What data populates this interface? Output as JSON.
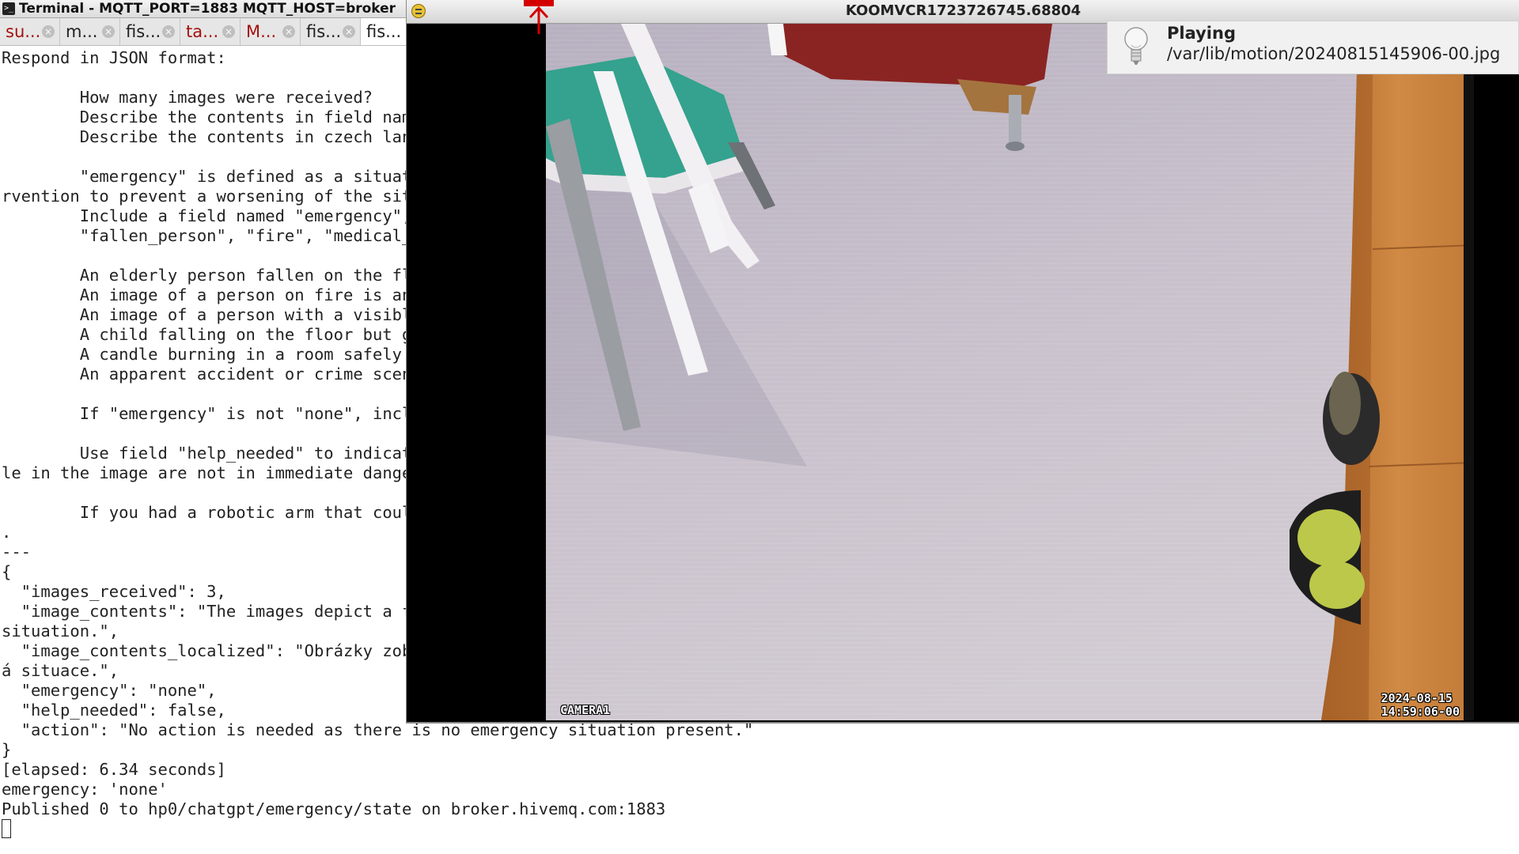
{
  "terminal": {
    "title": "Terminal - MQTT_PORT=1883 MQTT_HOST=broker",
    "icon": "terminal-icon",
    "tabs": [
      {
        "label": "su...",
        "color": "#a4100e"
      },
      {
        "label": "m...",
        "color": "#222222"
      },
      {
        "label": "fis...",
        "color": "#222222"
      },
      {
        "label": "ta...",
        "color": "#a4100e"
      },
      {
        "label": "M...",
        "color": "#a4100e"
      },
      {
        "label": "fis...",
        "color": "#222222"
      },
      {
        "label": "fis...",
        "color": "#222222"
      }
    ],
    "output_lines": [
      "Respond in JSON format:",
      "",
      "        How many images were received?",
      "        Describe the contents in field name",
      "        Describe the contents in czech lang",
      "",
      "        \"emergency\" is defined as a situati",
      "rvention to prevent a worsening of the situ",
      "        Include a field named \"emergency\",",
      "        \"fallen_person\", \"fire\", \"medical_e",
      "",
      "        An elderly person fallen on the flo",
      "        An image of a person on fire is an",
      "        An image of a person with a visible",
      "        A child falling on the floor but ge",
      "        A candle burning in a room safely i",
      "        An apparent accident or crime scene",
      "",
      "        If \"emergency\" is not \"none\", inclu",
      "",
      "        Use field \"help_needed\" to indicate",
      "le in the image are not in immediate danger",
      "",
      "        If you had a robotic arm that could",
      ".",
      "---",
      "{",
      "  \"images_received\": 3,",
      "  \"image_contents\": \"The images depict a fl",
      "situation.\",",
      "  \"image_contents_localized\": \"Obrázky zobr",
      "á situace.\",",
      "  \"emergency\": \"none\",",
      "  \"help_needed\": false,",
      "  \"action\": \"No action is needed as there is no emergency situation present.\"",
      "}",
      "[elapsed: 6.34 seconds]",
      "emergency: 'none'",
      "Published 0 to hp0/chatgpt/emergency/state on broker.hivemq.com:1883"
    ]
  },
  "viewer": {
    "title": "KOOMVCR1723726745.68804",
    "app_icon": "image-viewer-icon",
    "overlay_camera": "CAMERA1",
    "overlay_date": "2024-08-15",
    "overlay_time": "14:59:06-00"
  },
  "notification": {
    "icon": "lightbulb-icon",
    "title": "Playing",
    "body": "/var/lib/motion/20240815145906-00.jpg"
  }
}
